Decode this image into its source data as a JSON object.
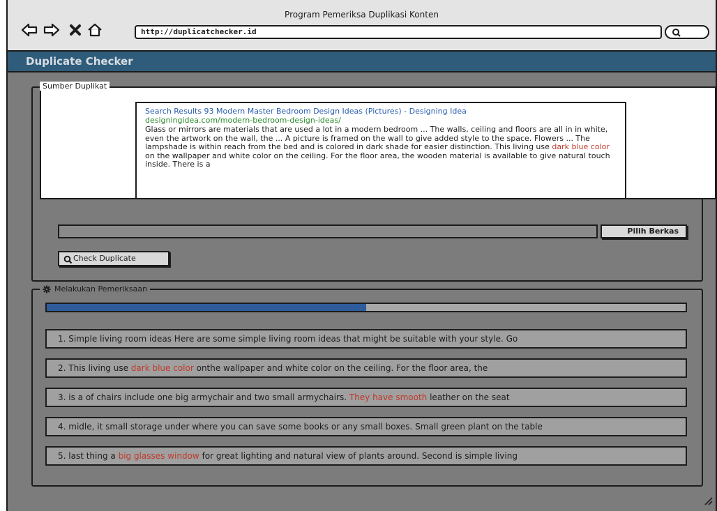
{
  "window": {
    "title": "Program Pemeriksa Duplikasi Konten",
    "url": "http://duplicatchecker.id"
  },
  "icons": {
    "back": "arrow-left-icon",
    "forward": "arrow-right-icon",
    "stop": "close-icon",
    "home": "home-icon",
    "search": "search-icon",
    "settings": "gear-icon"
  },
  "app": {
    "title": "Duplicate Checker"
  },
  "source": {
    "legend": "Sumber Duplikat",
    "result": {
      "title": "Search Results 93 Modern Master Bedroom Design Ideas (Pictures) - Designing Idea",
      "url": "designingidea.com/modern-bedroom-design-ideas/",
      "body_before": "Glass or mirrors are materials that are used a lot in a modern bedroom ... The walls, ceiling and floors are all in in white, even the artwork on the wall, the ... A picture is framed on the wall to give added style to the space. Flowers ... The lampshade is within reach from the bed and is colored in dark shade for easier distinction. This living use ",
      "body_highlight": "dark blue color",
      "body_after": " on the wallpaper and white color on the ceiling. For the floor area, the wooden material is available to give natural touch inside. There is a"
    },
    "file_value": "",
    "file_button": "Pilih Berkas",
    "check_button": "Check Duplicate"
  },
  "process": {
    "legend": "Melakukan Pemeriksaan",
    "progress": 0.5,
    "rows": [
      {
        "before": "1. Simple living room ideas Here are some simple living room ideas that might be suitable with your style. Go",
        "highlight": "",
        "after": ""
      },
      {
        "before": "2. This living use ",
        "highlight": "dark blue color",
        "after": "  onthe wallpaper and white color on the ceiling. For the floor area, the"
      },
      {
        "before": "3. is a of chairs include one big armychair and two small armychairs. ",
        "highlight": "They have smooth",
        "after": " leather on the seat"
      },
      {
        "before": "4. midle, it small storage under where you can save some books or any small boxes. Small green plant on the table",
        "highlight": "",
        "after": ""
      },
      {
        "before": "5. last thing a ",
        "highlight": "big glasses window",
        "after": " for great lighting and natural view of plants around. Second is simple living"
      }
    ]
  },
  "colors": {
    "header": "#2f5c7b",
    "progress": "#2f5c9b",
    "highlight": "#c0392b",
    "link_title": "#2a5db0",
    "link_url": "#2a8a2a"
  }
}
